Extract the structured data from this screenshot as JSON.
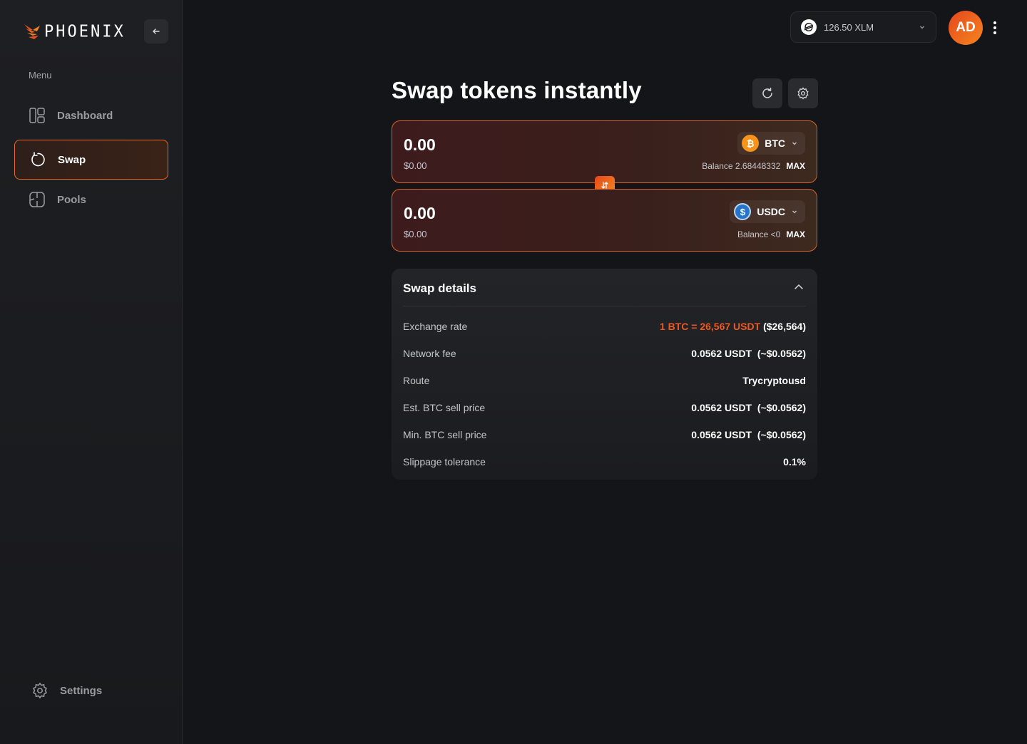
{
  "brand": {
    "name": "PHOENIX"
  },
  "sidebar": {
    "menu_label": "Menu",
    "items": [
      {
        "label": "Dashboard",
        "icon": "dashboard-icon",
        "active": false
      },
      {
        "label": "Swap",
        "icon": "swap-cycle-icon",
        "active": true
      },
      {
        "label": "Pools",
        "icon": "pools-icon",
        "active": false
      }
    ],
    "settings_label": "Settings"
  },
  "header": {
    "wallet_balance": "126.50 XLM",
    "avatar_initials": "AD"
  },
  "main": {
    "title": "Swap tokens instantly",
    "from": {
      "amount": "0.00",
      "usd_value": "$0.00",
      "token": "BTC",
      "balance": "Balance 2.68448332",
      "max_label": "MAX"
    },
    "to": {
      "amount": "0.00",
      "usd_value": "$0.00",
      "token": "USDC",
      "balance": "Balance <0",
      "max_label": "MAX"
    },
    "details": {
      "title": "Swap details",
      "rows": [
        {
          "label": "Exchange rate",
          "value_accent": "1 BTC = 26,567 USDT",
          "value": "($26,564)"
        },
        {
          "label": "Network fee",
          "value": "0.0562 USDT  (~$0.0562)"
        },
        {
          "label": "Route",
          "value": "Trycryptousd"
        },
        {
          "label": "Est. BTC sell price",
          "value": "0.0562 USDT  (~$0.0562)"
        },
        {
          "label": "Min. BTC sell price",
          "value": "0.0562 USDT  (~$0.0562)"
        },
        {
          "label": "Slippage tolerance",
          "value": "0.1%"
        }
      ]
    }
  },
  "colors": {
    "accent": "#e86a2a",
    "background": "#141518",
    "sidebar": "#1c1d20"
  }
}
